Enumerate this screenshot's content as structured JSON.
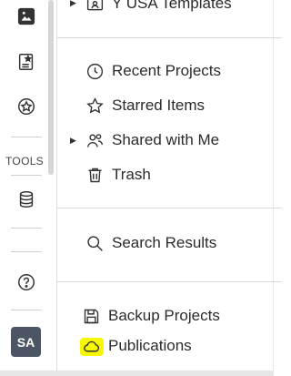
{
  "rail": {
    "tools_label": "TOOLS",
    "avatar_initials": "SA",
    "icons": [
      "image-icon",
      "starred-document-icon",
      "star-badge-icon",
      "database-icon",
      "help-icon"
    ]
  },
  "panel": {
    "templates_label": "Y USA Templates",
    "items": [
      {
        "label": "Recent Projects",
        "icon": "clock-icon"
      },
      {
        "label": "Starred Items",
        "icon": "star-icon"
      },
      {
        "label": "Shared with Me",
        "icon": "shared-users-icon"
      },
      {
        "label": "Trash",
        "icon": "trash-icon"
      },
      {
        "label": "Search Results",
        "icon": "search-icon"
      },
      {
        "label": "Backup Projects",
        "icon": "save-icon"
      },
      {
        "label": "Publications",
        "icon": "cloud-icon"
      }
    ]
  },
  "colors": {
    "highlight": "#f7f700",
    "avatar_bg": "#4b5563"
  }
}
